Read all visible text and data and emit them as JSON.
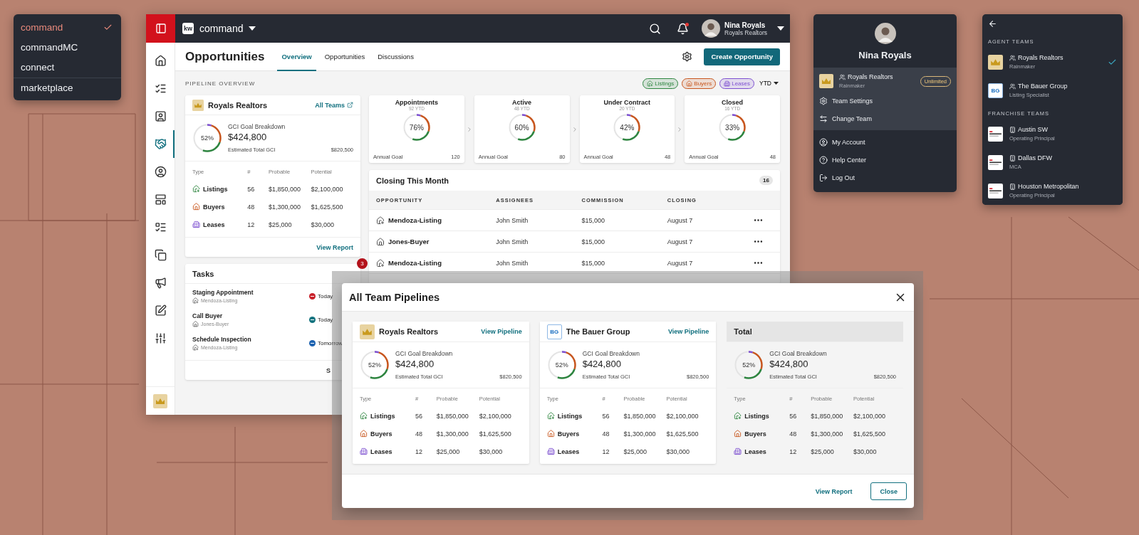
{
  "app_switcher": {
    "items": [
      {
        "label": "command",
        "selected": true
      },
      {
        "label": "commandMC",
        "selected": false
      },
      {
        "label": "connect",
        "selected": false
      },
      {
        "label": "marketplace",
        "selected": false
      }
    ]
  },
  "app": {
    "brand": "kw",
    "product": "command",
    "user": {
      "name": "Nina Royals",
      "team": "Royals Realtors"
    },
    "sidebar": {
      "items": [
        {
          "selected": false
        },
        {
          "selected": false
        },
        {
          "selected": false
        },
        {
          "selected": true
        },
        {
          "selected": false
        },
        {
          "selected": false
        },
        {
          "selected": false
        },
        {
          "selected": false
        },
        {
          "selected": false
        },
        {
          "selected": false
        },
        {
          "selected": false
        }
      ]
    },
    "page": {
      "title": "Opportunities",
      "tabs": [
        {
          "label": "Overview",
          "selected": true
        },
        {
          "label": "Opportunities",
          "selected": false
        },
        {
          "label": "Discussions",
          "selected": false
        }
      ],
      "create_button": "Create Opportunity"
    },
    "pipeline_label": "PIPELINE OVERVIEW",
    "filters": [
      {
        "kind": "listing",
        "label": "Listings",
        "color": "#2e8540"
      },
      {
        "kind": "buyer",
        "label": "Buyers",
        "color": "#c8561e"
      },
      {
        "kind": "lease",
        "label": "Leases",
        "color": "#7d4fd0"
      }
    ],
    "period": "YTD",
    "team_card": {
      "name": "Royals Realtors",
      "link": "All Teams",
      "footer_link": "View Report",
      "gci": {
        "percent": "52%",
        "title": "GCI Goal Breakdown",
        "amount": "$424,800",
        "estimate_label": "Estimated Total GCI",
        "estimate": "$820,500"
      },
      "columns": [
        "Type",
        "#",
        "Probable",
        "Potential"
      ],
      "rows": [
        {
          "kind": "listing",
          "type": "Listings",
          "count": "56",
          "probable": "$1,850,000",
          "potential": "$2,100,000"
        },
        {
          "kind": "buyer",
          "type": "Buyers",
          "count": "48",
          "probable": "$1,300,000",
          "potential": "$1,625,500"
        },
        {
          "kind": "lease",
          "type": "Leases",
          "count": "12",
          "probable": "$25,000",
          "potential": "$30,000"
        }
      ]
    },
    "stats": [
      {
        "title": "Appointments",
        "subtitle": "92 YTD",
        "percent": "76%",
        "goal_label": "Annual Goal",
        "goal": "120"
      },
      {
        "title": "Active",
        "subtitle": "48 YTD",
        "percent": "60%",
        "goal_label": "Annual Goal",
        "goal": "80"
      },
      {
        "title": "Under Contract",
        "subtitle": "20 YTD",
        "percent": "42%",
        "goal_label": "Annual Goal",
        "goal": "48"
      },
      {
        "title": "Closed",
        "subtitle": "16 YTD",
        "percent": "33%",
        "goal_label": "Annual Goal",
        "goal": "48"
      }
    ],
    "closing": {
      "title": "Closing This Month",
      "count": "16",
      "columns": [
        "OPPORTUNITY",
        "ASSIGNEES",
        "COMMISSION",
        "CLOSING"
      ],
      "rows": [
        {
          "kind": "listing",
          "name": "Mendoza-Listing",
          "assignee": "John Smith",
          "commission": "$15,000",
          "closing": "August 7"
        },
        {
          "kind": "buyer",
          "name": "Jones-Buyer",
          "assignee": "John Smith",
          "commission": "$15,000",
          "closing": "August 7"
        },
        {
          "kind": "listing",
          "name": "Mendoza-Listing",
          "assignee": "John Smith",
          "commission": "$15,000",
          "closing": "August 7"
        }
      ]
    },
    "tasks": {
      "title": "Tasks",
      "badge": "3",
      "footer": "S",
      "items": [
        {
          "title": "Staging Appointment",
          "kind": "listing",
          "related": "Mendoza-Listing",
          "due": "Today",
          "color": "#c8202a"
        },
        {
          "title": "Call Buyer",
          "kind": "buyer",
          "related": "Jones-Buyer",
          "due": "Today",
          "color": "#14737f"
        },
        {
          "title": "Schedule Inspection",
          "kind": "listing",
          "related": "Mendoza-Listing",
          "due": "Tomorrow",
          "color": "#1d62b0"
        }
      ]
    }
  },
  "profile_menu": {
    "name": "Nina Royals",
    "team": {
      "name": "Royals Realtors",
      "role": "Rainmaker",
      "badge": "Unlimited"
    },
    "team_actions": [
      {
        "kind": "settings",
        "label": "Team Settings"
      },
      {
        "kind": "change",
        "label": "Change Team"
      }
    ],
    "account_actions": [
      {
        "kind": "account",
        "label": "My Account"
      },
      {
        "kind": "help",
        "label": "Help Center"
      },
      {
        "kind": "logout",
        "label": "Log Out"
      }
    ]
  },
  "teams_panel": {
    "sections": [
      {
        "kind": "agent",
        "title": "AGENT TEAMS",
        "teams": [
          {
            "kind": "crown",
            "name": "Royals Realtors",
            "role": "Rainmaker",
            "selected": true
          },
          {
            "kind": "initials",
            "logo_text": "BG",
            "name": "The Bauer Group",
            "role": "Listing Specialist",
            "selected": false
          }
        ]
      },
      {
        "kind": "franchise",
        "title": "FRANCHISE TEAMS",
        "teams": [
          {
            "kind": "franchise",
            "name": "Austin SW",
            "role": "Operating Principal",
            "selected": false
          },
          {
            "kind": "franchise",
            "name": "Dallas DFW",
            "role": "MCA",
            "selected": false
          },
          {
            "kind": "franchise",
            "name": "Houston Metropolitan",
            "role": "Operating Principal",
            "selected": false
          }
        ]
      }
    ]
  },
  "modal": {
    "title": "All Team Pipelines",
    "cards": [
      {
        "kind": "team",
        "name": "Royals Realtors",
        "link": "View Pipeline",
        "gci": {
          "percent": "52%",
          "title": "GCI Goal Breakdown",
          "amount": "$424,800",
          "estimate_label": "Estimated Total GCI",
          "estimate": "$820,500"
        },
        "columns": [
          "Type",
          "#",
          "Probable",
          "Potential"
        ],
        "rows": [
          {
            "kind": "listing",
            "type": "Listings",
            "count": "56",
            "probable": "$1,850,000",
            "potential": "$2,100,000"
          },
          {
            "kind": "buyer",
            "type": "Buyers",
            "count": "48",
            "probable": "$1,300,000",
            "potential": "$1,625,500"
          },
          {
            "kind": "lease",
            "type": "Leases",
            "count": "12",
            "probable": "$25,000",
            "potential": "$30,000"
          }
        ]
      },
      {
        "kind": "team",
        "logo_text": "BG",
        "name": "The Bauer Group",
        "link": "View Pipeline",
        "gci": {
          "percent": "52%",
          "title": "GCI Goal Breakdown",
          "amount": "$424,800",
          "estimate_label": "Estimated Total GCI",
          "estimate": "$820,500"
        },
        "columns": [
          "Type",
          "#",
          "Probable",
          "Potential"
        ],
        "rows": [
          {
            "kind": "listing",
            "type": "Listings",
            "count": "56",
            "probable": "$1,850,000",
            "potential": "$2,100,000"
          },
          {
            "kind": "buyer",
            "type": "Buyers",
            "count": "48",
            "probable": "$1,300,000",
            "potential": "$1,625,500"
          },
          {
            "kind": "lease",
            "type": "Leases",
            "count": "12",
            "probable": "$25,000",
            "potential": "$30,000"
          }
        ]
      },
      {
        "kind": "total",
        "name": "Total",
        "gci": {
          "percent": "52%",
          "title": "GCI Goal Breakdown",
          "amount": "$424,800",
          "estimate_label": "Estimated Total GCI",
          "estimate": "$820,500"
        },
        "columns": [
          "Type",
          "#",
          "Probable",
          "Potential"
        ],
        "rows": [
          {
            "kind": "listing",
            "type": "Listings",
            "count": "56",
            "probable": "$1,850,000",
            "potential": "$2,100,000"
          },
          {
            "kind": "buyer",
            "type": "Buyers",
            "count": "48",
            "probable": "$1,300,000",
            "potential": "$1,625,500"
          },
          {
            "kind": "lease",
            "type": "Leases",
            "count": "12",
            "probable": "$25,000",
            "potential": "$30,000"
          }
        ]
      }
    ],
    "buttons": [
      {
        "kind": "link",
        "label": "View Report"
      },
      {
        "kind": "outline",
        "label": "Close"
      }
    ]
  }
}
